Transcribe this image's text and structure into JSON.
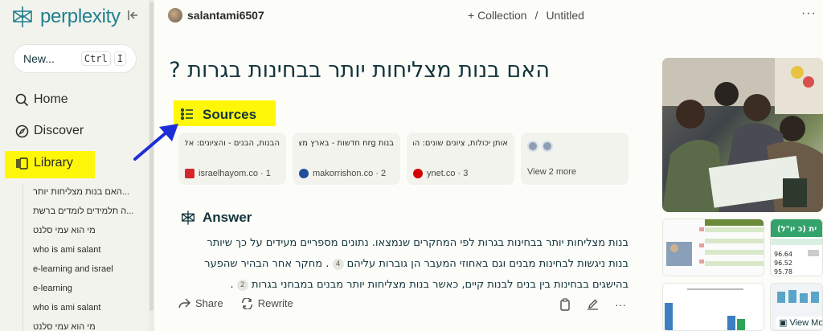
{
  "brand": {
    "name": "perplexity"
  },
  "sidebar": {
    "new_label": "New...",
    "shortcut": [
      "Ctrl",
      "I"
    ],
    "nav": [
      {
        "label": "Home",
        "icon": "search-icon"
      },
      {
        "label": "Discover",
        "icon": "compass-icon"
      },
      {
        "label": "Library",
        "icon": "library-icon"
      }
    ],
    "library_items": [
      "האם בנות מצליחות יותר...",
      "ה תלמידים לומדים ברשת...",
      "מי הוא עמי סלנט",
      "who is ami salant",
      "e-learning and israel",
      "e-learning",
      "who is ami salant",
      "מי הוא עמי סלנט"
    ]
  },
  "topbar": {
    "username": "salantami6507",
    "collection_label": "+ Collection",
    "separator": "/",
    "page_name": "Untitled",
    "more": "···"
  },
  "thread": {
    "title": "האם בנות מצליחות יותר בבחינות בגרות ?",
    "sources_heading": "Sources",
    "sources": [
      {
        "text": "הבנות, הבנים - והציונים: אלו פערי המגדר בחינוך בישראל",
        "domain": "israelhayom.co",
        "index": "1",
        "fav_color": "#d4262b"
      },
      {
        "text": "בנות nrg חדשות - בארץ מצליחות יותר מבנים במבחני",
        "domain": "makorrishon.co",
        "index": "2",
        "fav_color": "#1e4f9c"
      },
      {
        "text": "אותן יכולות, ציונים שונים: המחקר שבדק מדוע בנות",
        "domain": "ynet.co",
        "index": "3",
        "fav_color": "#d40000"
      }
    ],
    "view_more": "View 2 more",
    "answer_heading": "Answer",
    "answer_lines": [
      "בנות מצליחות יותר בבחינות בגרות לפי המחקרים שנמצאו. נתונים מספריים מעידים על כך שיותר",
      "בנות ניגשות לבחינות מבנים וגם באחוזי המעבר הן גוברות עליהם",
      ". מחקר אחר הבהיר שהפער",
      "בהישגים בבחינות בין בנים לבנות קיים, כאשר בנות מצליחות יותר מבנים במבחני בגרות",
      "."
    ],
    "citations": [
      "4",
      "2"
    ],
    "actions": {
      "share": "Share",
      "rewrite": "Rewrite"
    }
  },
  "images": {
    "view_more": "View Mo",
    "tag": "ית (כ יו\"ל)"
  },
  "colors": {
    "accent": "#20808d",
    "highlight": "#fff70a",
    "arrow": "#1c2fd6"
  }
}
